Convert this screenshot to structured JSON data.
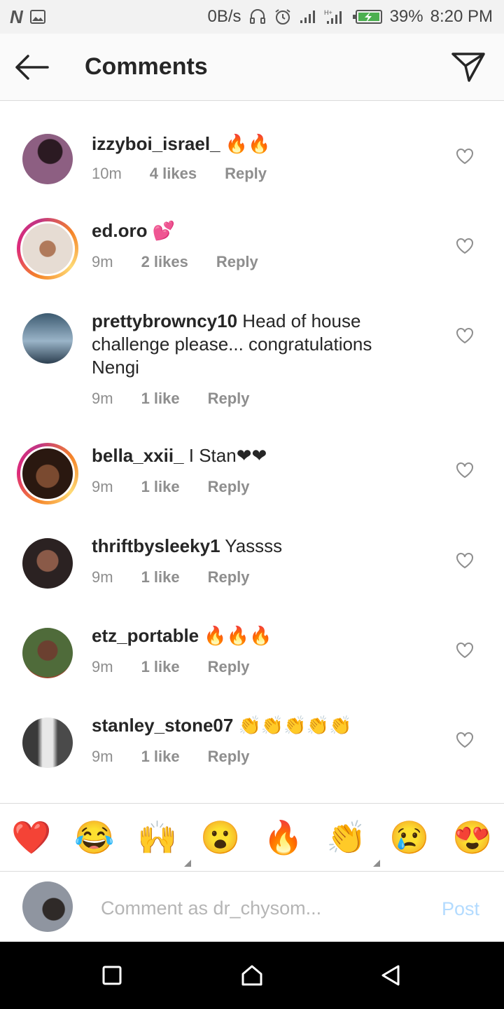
{
  "status_bar": {
    "net_speed": "0B/s",
    "battery": "39%",
    "time": "8:20 PM",
    "icons": [
      "n-logo-icon",
      "gallery-icon",
      "headset-icon",
      "alarm-icon",
      "signal-icon",
      "signal-h-plus-icon",
      "battery-charging-icon"
    ]
  },
  "header": {
    "title": "Comments",
    "back_icon": "arrow-left-icon",
    "send_icon": "direct-send-icon"
  },
  "comments": [
    {
      "username": "izzyboi_israel_",
      "text": " 🔥🔥",
      "time": "10m",
      "likes": "4 likes",
      "reply": "Reply",
      "story_ring": false,
      "avatar_color": "#7b4f6e"
    },
    {
      "username": "ed.oro",
      "text": " 💕",
      "time": "9m",
      "likes": "2 likes",
      "reply": "Reply",
      "story_ring": true,
      "avatar_color": "#c9b7a8"
    },
    {
      "username": "prettybrowncy10",
      "text": " Head of house challenge please... congratulations Nengi",
      "time": "9m",
      "likes": "1 like",
      "reply": "Reply",
      "story_ring": false,
      "avatar_color": "#6f8fa8"
    },
    {
      "username": "bella_xxii_",
      "text": " I Stan❤❤",
      "time": "9m",
      "likes": "1 like",
      "reply": "Reply",
      "story_ring": true,
      "avatar_color": "#5a3a2a"
    },
    {
      "username": "thriftbysleeky1",
      "text": " Yassss",
      "time": "9m",
      "likes": "1 like",
      "reply": "Reply",
      "story_ring": false,
      "avatar_color": "#4a3a36"
    },
    {
      "username": "etz_portable",
      "text": " 🔥🔥🔥",
      "time": "9m",
      "likes": "1 like",
      "reply": "Reply",
      "story_ring": false,
      "avatar_color": "#5d6b3e"
    },
    {
      "username": "stanley_stone07",
      "text": " 👏👏👏👏👏",
      "time": "9m",
      "likes": "1 like",
      "reply": "Reply",
      "story_ring": false,
      "avatar_color": "#8a8a8a"
    }
  ],
  "reactions": [
    "❤️",
    "😂",
    "🙌",
    "😮",
    "🔥",
    "👏",
    "😢",
    "😍"
  ],
  "composer": {
    "placeholder": "Comment as dr_chysom...",
    "post_label": "Post"
  },
  "nav_icons": [
    "recent-apps-icon",
    "home-icon",
    "back-icon"
  ]
}
